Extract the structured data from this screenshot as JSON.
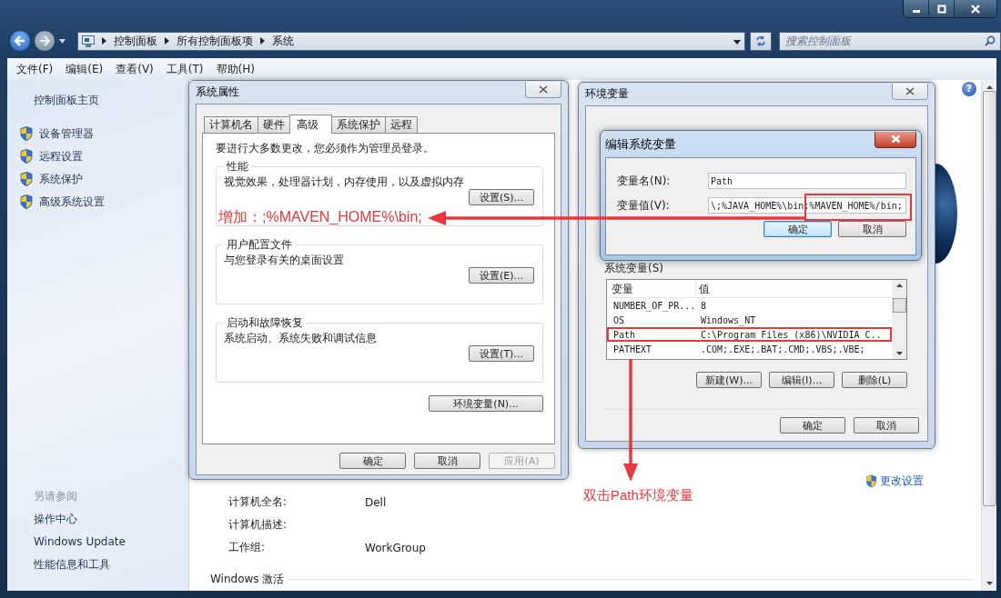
{
  "address_bar": {
    "breadcrumbs": [
      "控制面板",
      "所有控制面板项",
      "系统"
    ]
  },
  "search": {
    "placeholder": "搜索控制面板"
  },
  "menu": [
    "文件(F)",
    "编辑(E)",
    "查看(V)",
    "工具(T)",
    "帮助(H)"
  ],
  "sidebar": {
    "home": "控制面板主页",
    "tasks": [
      "设备管理器",
      "远程设置",
      "系统保护",
      "高级系统设置"
    ],
    "see_also_title": "另请参阅",
    "see_also": [
      "操作中心",
      "Windows Update",
      "性能信息和工具"
    ]
  },
  "help_button": "?",
  "computer_info": {
    "change_settings": "更改设置",
    "rows": [
      {
        "label": "计算机全名:",
        "value": "Dell"
      },
      {
        "label": "计算机描述:"
      },
      {
        "label": "工作组:",
        "value": "WorkGroup"
      }
    ]
  },
  "activation_heading": "Windows 激活",
  "system_properties": {
    "title": "系统属性",
    "tabs": [
      {
        "label": "计算机名",
        "selected": false
      },
      {
        "label": "硬件",
        "selected": false
      },
      {
        "label": "高级",
        "selected": true
      },
      {
        "label": "系统保护",
        "selected": false
      },
      {
        "label": "远程",
        "selected": false
      }
    ],
    "notice": "要进行大多数更改，您必须作为管理员登录。",
    "groups": [
      {
        "title": "性能",
        "description": "视觉效果，处理器计划，内存使用，以及虚拟内存",
        "button": "设置(S)..."
      },
      {
        "title": "用户配置文件",
        "description": "与您登录有关的桌面设置",
        "button": "设置(E)..."
      },
      {
        "title": "启动和故障恢复",
        "description": "系统启动、系统失败和调试信息",
        "button": "设置(T)..."
      }
    ],
    "env_button": "环境变量(N)...",
    "buttons": [
      {
        "label": "确定",
        "disabled": false
      },
      {
        "label": "取消",
        "disabled": false
      },
      {
        "label": "应用(A)",
        "disabled": true
      }
    ]
  },
  "environment_variables": {
    "title": "环境变量",
    "system_vars_label": "系统变量(S)",
    "columns": [
      "变量",
      "值"
    ],
    "rows": [
      {
        "name": "NUMBER_OF_PR...",
        "value": "8",
        "highlighted": false
      },
      {
        "name": "OS",
        "value": "Windows_NT",
        "highlighted": false
      },
      {
        "name": "Path",
        "value": "C:\\Program Files (x86)\\NVIDIA C..",
        "highlighted": true
      },
      {
        "name": "PATHEXT",
        "value": ".COM;.EXE;.BAT;.CMD;.VBS;.VBE;",
        "highlighted": false
      }
    ],
    "list_buttons": [
      "新建(W)...",
      "编辑(I)...",
      "删除(L)"
    ],
    "buttons": [
      "确定",
      "取消"
    ]
  },
  "edit_variable": {
    "title": "编辑系统变量",
    "name_label": "变量名(N):",
    "name_value": "Path",
    "value_label": "变量值(V):",
    "value": "\\;%JAVA_HOME%\\bin;%MAVEN_HOME%/bin;",
    "buttons": [
      {
        "label": "确定",
        "default": true
      },
      {
        "label": "取消",
        "default": false
      }
    ]
  },
  "annotations": [
    {
      "kind": "left-arrow-note",
      "text": "增加：;%MAVEN_HOME%\\bin;"
    },
    {
      "kind": "down-arrow-note",
      "text": "双击Path环境变量"
    }
  ]
}
